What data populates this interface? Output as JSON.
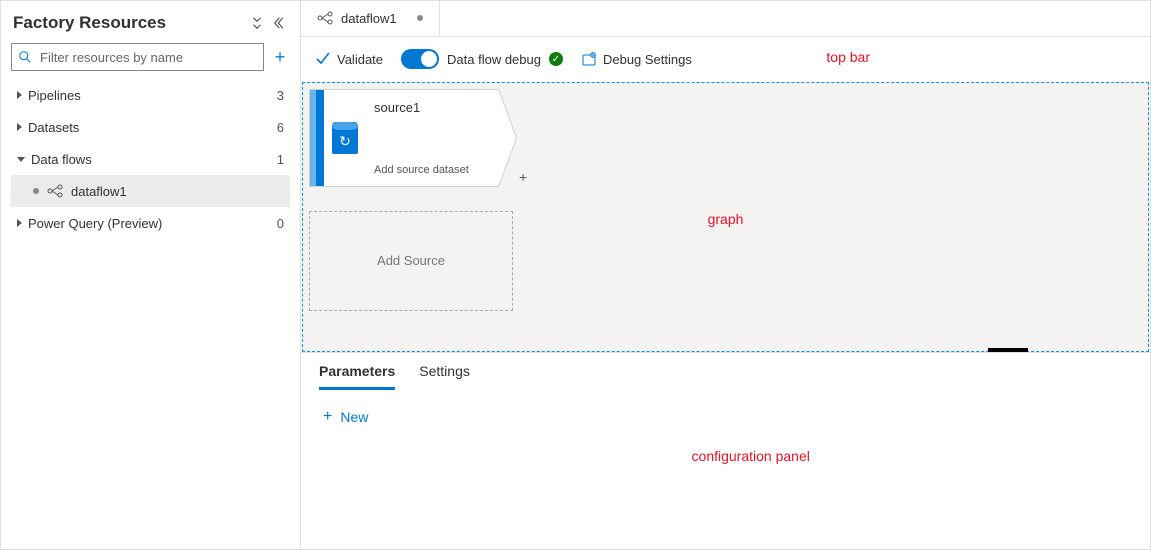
{
  "sidebar": {
    "title": "Factory Resources",
    "filter_placeholder": "Filter resources by name",
    "items": [
      {
        "label": "Pipelines",
        "count": "3",
        "expanded": false
      },
      {
        "label": "Datasets",
        "count": "6",
        "expanded": false
      },
      {
        "label": "Data flows",
        "count": "1",
        "expanded": true,
        "children": [
          {
            "label": "dataflow1"
          }
        ]
      },
      {
        "label": "Power Query (Preview)",
        "count": "0",
        "expanded": false
      }
    ]
  },
  "tab": {
    "title": "dataflow1"
  },
  "toolbar": {
    "validate": "Validate",
    "debug_label": "Data flow debug",
    "debug_on": true,
    "debug_settings": "Debug Settings"
  },
  "graph": {
    "source": {
      "name": "source1",
      "subtitle": "Add source dataset"
    },
    "add_source": "Add Source"
  },
  "config": {
    "tabs": [
      {
        "label": "Parameters",
        "active": true
      },
      {
        "label": "Settings",
        "active": false
      }
    ],
    "new_button": "New"
  },
  "annotations": {
    "top_bar": "top bar",
    "graph": "graph",
    "config": "configuration panel"
  }
}
